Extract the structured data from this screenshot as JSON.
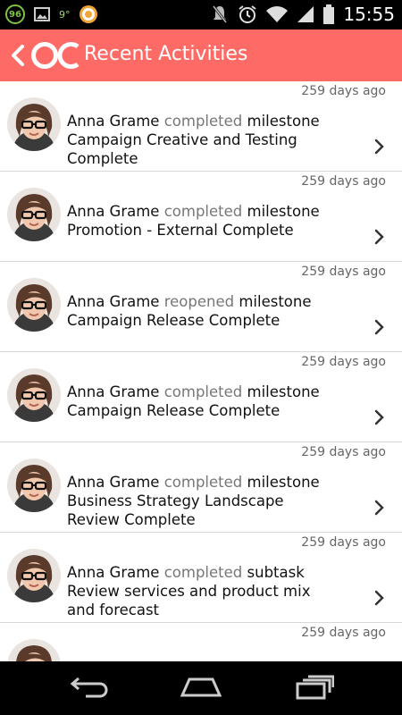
{
  "status_bar": {
    "notification_badge": "96",
    "temperature": "9°",
    "time": "15:55"
  },
  "app_bar": {
    "title": "Recent Activities",
    "background_color": "#fe6b66"
  },
  "activities": [
    {
      "user": "Anna Grame",
      "verb": "completed",
      "object_type": "milestone",
      "object_name": "Campaign Creative and Testing Complete",
      "time_ago": "259 days ago"
    },
    {
      "user": "Anna Grame",
      "verb": "completed",
      "object_type": "milestone",
      "object_name": "Promotion - External Complete",
      "time_ago": "259 days ago"
    },
    {
      "user": "Anna Grame",
      "verb": "reopened",
      "object_type": "milestone",
      "object_name": "Campaign Release Complete",
      "time_ago": "259 days ago"
    },
    {
      "user": "Anna Grame",
      "verb": "completed",
      "object_type": "milestone",
      "object_name": "Campaign Release Complete",
      "time_ago": "259 days ago"
    },
    {
      "user": "Anna Grame",
      "verb": "completed",
      "object_type": "milestone",
      "object_name": "Business Strategy Landscape Review Complete",
      "time_ago": "259 days ago"
    },
    {
      "user": "Anna Grame",
      "verb": "completed",
      "object_type": "subtask",
      "object_name": "Review services and product mix and forecast",
      "time_ago": "259 days ago"
    },
    {
      "user": "",
      "verb": "",
      "object_type": "",
      "object_name": "",
      "time_ago": "259 days ago"
    }
  ]
}
